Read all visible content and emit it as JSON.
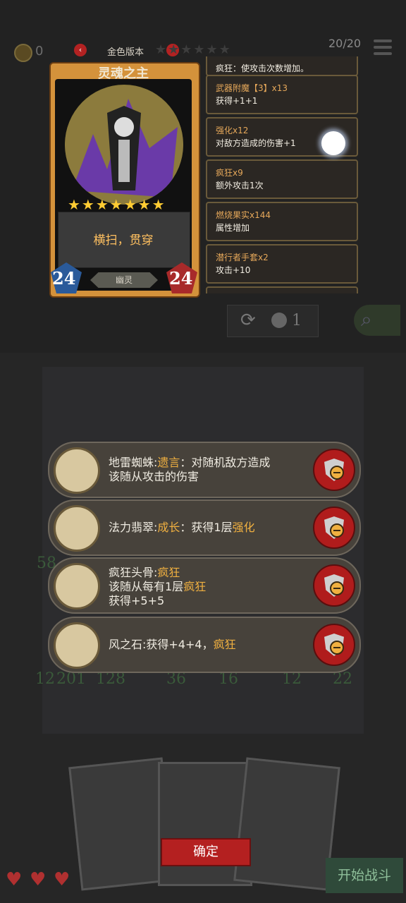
{
  "topbar": {
    "coin_value": "0",
    "version_label": "金色版本",
    "prev_glyph": "‹",
    "next_glyph": "›",
    "counter": "20/20"
  },
  "card": {
    "name": "灵魂之主",
    "stars": 7,
    "description": "横扫，贯穿",
    "attack": "24",
    "health": "24",
    "type": "幽灵"
  },
  "effects": [
    {
      "name": "疯狂：使攻击次数增加。",
      "desc": ""
    },
    {
      "name": "武器附魔【3】x13",
      "desc": "获得+1+1"
    },
    {
      "name": "强化x12",
      "desc": "对敌方造成的伤害+1"
    },
    {
      "name": "疯狂x9",
      "desc": "额外攻击1次"
    },
    {
      "name": "燃烧果实x144",
      "desc": "属性增加"
    },
    {
      "name": "潜行者手套x2",
      "desc": "攻击+10"
    }
  ],
  "refresh_count": "1",
  "relics": [
    {
      "name": "地雷蜘蛛:",
      "tag": "遗言",
      "text": "：对随机敌方造成",
      "line2": "该随从攻击的伤害",
      "line3": ""
    },
    {
      "name": "法力翡翠:",
      "tag": "成长",
      "text": "：获得1层",
      "tag2": "强化",
      "line2": "",
      "line3": ""
    },
    {
      "name": "疯狂头骨:",
      "tag": "疯狂",
      "text": "",
      "line2": "该随从每有1层",
      "tag3": "疯狂",
      "line3": "获得+5+5"
    },
    {
      "name": "风之石:获得+4+4，",
      "tag": "疯狂",
      "text": "",
      "line2": "",
      "line3": ""
    }
  ],
  "background_numbers": [
    "58",
    "12",
    "201",
    "128",
    "36",
    "16",
    "12",
    "22"
  ],
  "buttons": {
    "confirm": "确定",
    "start_battle": "开始战斗"
  },
  "hearts": [
    "♥",
    "♥",
    "♥"
  ],
  "colors": {
    "accent_red": "#b01c1c",
    "highlight_orange": "#f0b040",
    "card_gold": "#d4923b"
  }
}
